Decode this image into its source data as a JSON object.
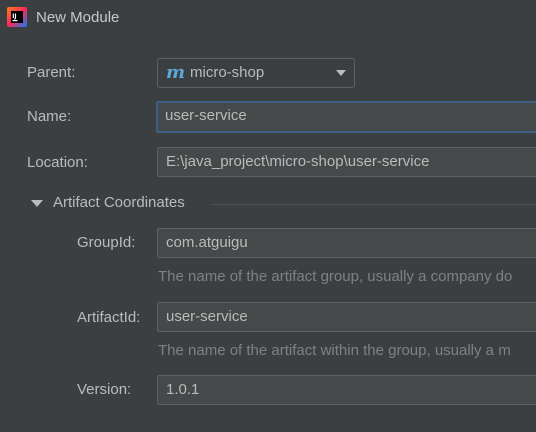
{
  "window": {
    "title": "New Module",
    "app_icon": "intellij-idea-icon"
  },
  "parent": {
    "label": "Parent:",
    "value": "micro-shop",
    "icon_glyph": "m",
    "icon_color": "#5ca9d8"
  },
  "name": {
    "label": "Name:",
    "value": "user-service"
  },
  "location": {
    "label": "Location:",
    "value": "E:\\java_project\\micro-shop\\user-service"
  },
  "artifact_coordinates": {
    "title": "Artifact Coordinates",
    "expanded": true,
    "group_id": {
      "label": "GroupId:",
      "value": "com.atguigu",
      "hint": "The name of the artifact group, usually a company do"
    },
    "artifact_id": {
      "label": "ArtifactId:",
      "value": "user-service",
      "hint": "The name of the artifact within the group, usually a m"
    },
    "version": {
      "label": "Version:",
      "value": "1.0.1"
    }
  },
  "colors": {
    "background": "#3c3f41",
    "field_background": "#45494a",
    "focus_border": "#3d6185",
    "text": "#bbbbbb",
    "hint_text": "#808080"
  }
}
